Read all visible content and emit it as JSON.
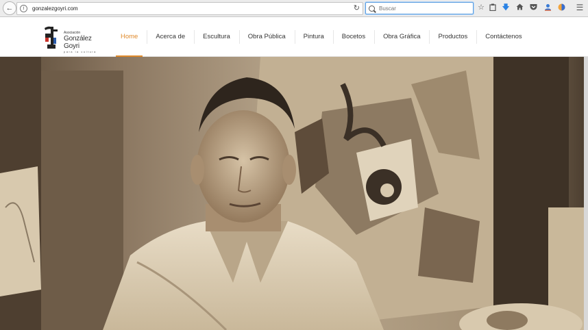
{
  "browser": {
    "url": "gonzalezgoyri.com",
    "search_placeholder": "Buscar",
    "toolbar_icons": [
      "back-icon",
      "info-icon",
      "reload-icon",
      "search-icon",
      "bookmark-star-icon",
      "clipboard-icon",
      "download-icon",
      "home-icon",
      "pocket-icon",
      "account-icon",
      "extension-icon",
      "menu-icon"
    ]
  },
  "site": {
    "logo": {
      "small": "Asociación",
      "name": "González Goyri",
      "sub": "para la cultura"
    },
    "nav": [
      {
        "label": "Home",
        "active": true
      },
      {
        "label": "Acerca de",
        "active": false
      },
      {
        "label": "Escultura",
        "active": false
      },
      {
        "label": "Obra Pública",
        "active": false
      },
      {
        "label": "Pintura",
        "active": false
      },
      {
        "label": "Bocetos",
        "active": false
      },
      {
        "label": "Obra Gráfica",
        "active": false
      },
      {
        "label": "Productos",
        "active": false
      },
      {
        "label": "Contáctenos",
        "active": false
      }
    ],
    "accent_color": "#e08a2b",
    "hero": {
      "tone": "sepia photograph of the artist in front of an abstract painting"
    }
  }
}
